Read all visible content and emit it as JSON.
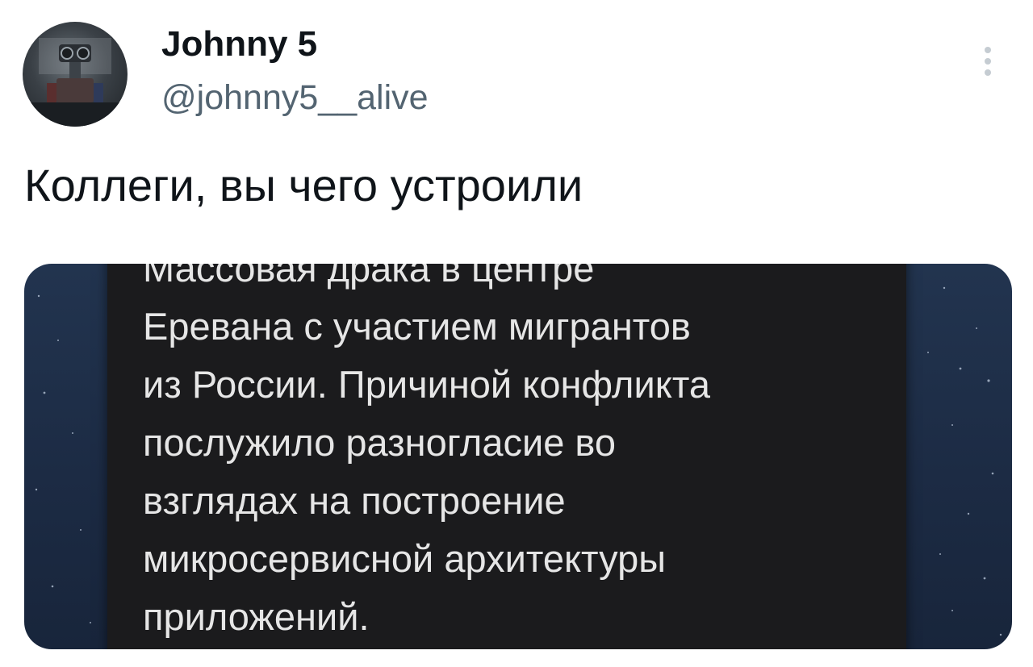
{
  "tweet": {
    "author": {
      "display_name": "Johnny 5",
      "handle": "@johnny5__alive",
      "avatar_icon": "robot-avatar-photo"
    },
    "more_icon": "vertical-ellipsis-icon",
    "text": "Коллеги, вы чего устроили",
    "media": {
      "lines": [
        "Массовая драка в центре",
        "Еревана с участием мигрантов",
        "из России. Причиной конфликта",
        "послужило разногласие во",
        "взглядах на построение",
        "микросервисной архитектуры",
        "приложений."
      ]
    }
  },
  "colors": {
    "primary_text": "#0f1419",
    "secondary_text": "#536471",
    "media_background": "#1c2b44",
    "screenshot_background": "#1b1b1d",
    "screenshot_text": "#e6e6e6"
  }
}
